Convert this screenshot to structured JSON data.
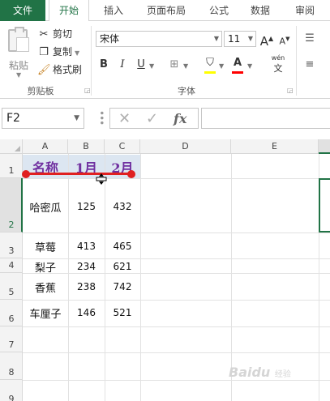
{
  "tabs": {
    "file": "文件",
    "home": "开始",
    "insert": "插入",
    "layout": "页面布局",
    "formula": "公式",
    "data": "数据",
    "review": "审阅"
  },
  "clipboard": {
    "paste": "粘贴",
    "cut": "剪切",
    "copy": "复制",
    "format_painter": "格式刷",
    "group_label": "剪贴板"
  },
  "font": {
    "name": "宋体",
    "size": "11",
    "grow": "A",
    "shrink": "A",
    "bold": "B",
    "italic": "I",
    "underline": "U",
    "font_color": "A",
    "phonetic": "wén",
    "phonetic_glyph": "文",
    "group_label": "字体"
  },
  "formula_bar": {
    "cell_ref": "F2",
    "fx": "fx",
    "value": ""
  },
  "columns": [
    "A",
    "B",
    "C",
    "D",
    "E"
  ],
  "rows": [
    "1",
    "2",
    "3",
    "4",
    "5",
    "6",
    "7",
    "8",
    "9"
  ],
  "cells": {
    "header": [
      "名称",
      "1月",
      "2月"
    ],
    "data": [
      [
        "哈密瓜",
        "125",
        "432"
      ],
      [
        "草莓",
        "413",
        "465"
      ],
      [
        "梨子",
        "234",
        "621"
      ],
      [
        "香蕉",
        "238",
        "742"
      ],
      [
        "车厘子",
        "146",
        "521"
      ]
    ]
  },
  "colors": {
    "accent": "#217346",
    "header_fill": "#dce6f1",
    "header_text": "#7030a0",
    "annotation": "#e02020"
  },
  "watermark": {
    "brand": "Baidu",
    "sub": "经验"
  }
}
